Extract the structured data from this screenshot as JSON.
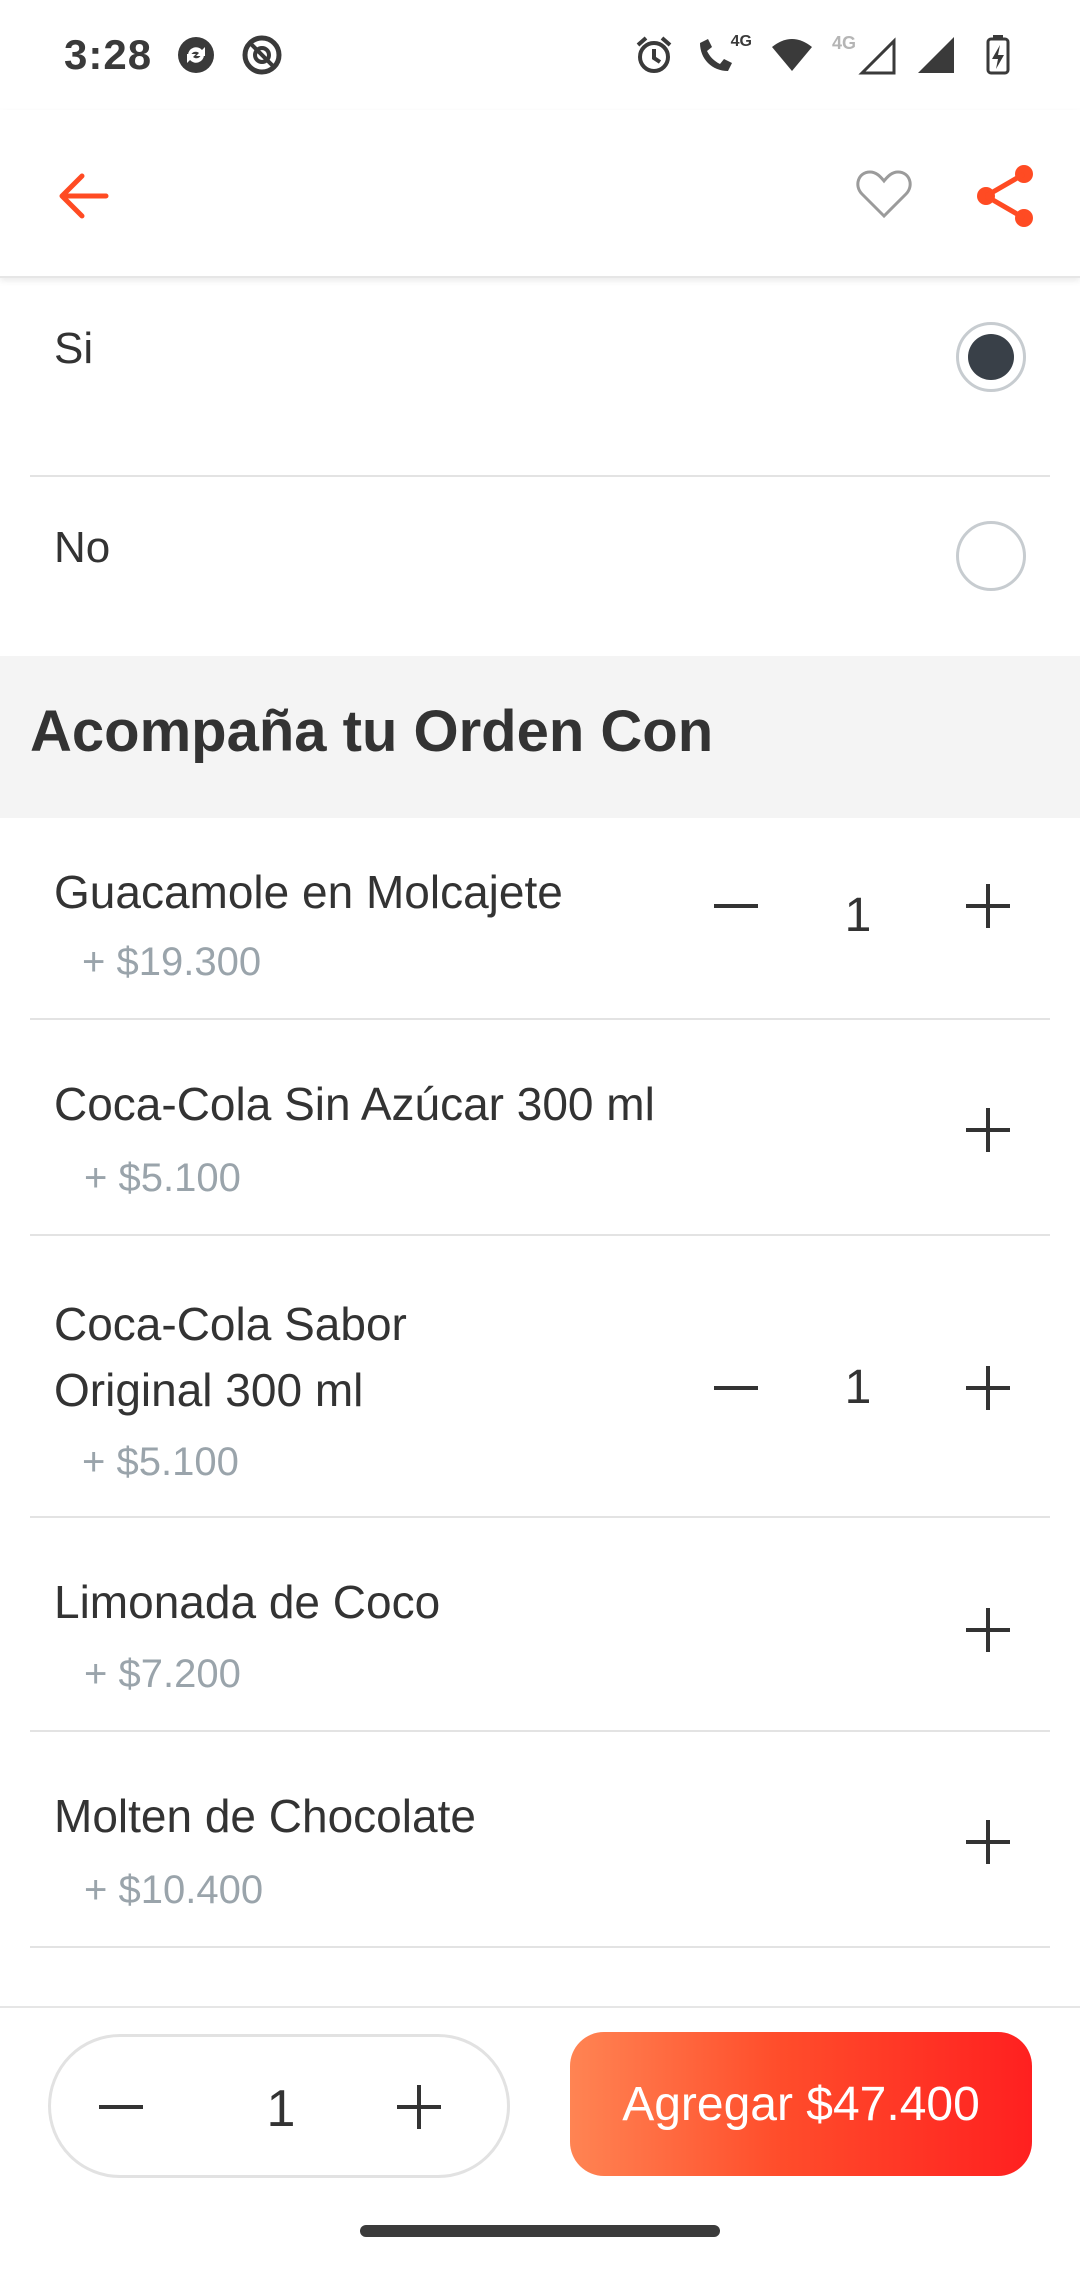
{
  "status_bar": {
    "time": "3:28",
    "left_icons": [
      "sync-icon",
      "no-disturb-icon"
    ],
    "right_icons": [
      "alarm-icon",
      "volte-call-icon",
      "wifi-icon",
      "signal-4g-icon",
      "signal-icon",
      "signal-icon-2",
      "battery-charging-icon"
    ],
    "call_badge": "4G",
    "network_badge": "4G"
  },
  "app_bar": {
    "back_icon": "arrow-left-icon",
    "favorite_icon": "heart-icon",
    "share_icon": "share-icon",
    "accent_color": "#ff4b23"
  },
  "options": [
    {
      "label": "Si",
      "selected": true
    },
    {
      "label": "No",
      "selected": false
    }
  ],
  "section": {
    "title": "Acompaña tu Orden Con"
  },
  "items": [
    {
      "name": "Guacamole en Molcajete",
      "price": "+ $19.300",
      "quantity": "1",
      "has_minus": true
    },
    {
      "name": "Coca-Cola Sin Azúcar 300 ml",
      "price": "+ $5.100",
      "quantity": "",
      "has_minus": false
    },
    {
      "name_line1": "Coca-Cola Sabor",
      "name_line2": "Original 300 ml",
      "price": "+ $5.100",
      "quantity": "1",
      "has_minus": true
    },
    {
      "name": "Limonada de Coco",
      "price": "+ $7.200",
      "quantity": "",
      "has_minus": false
    },
    {
      "name": "Molten de Chocolate",
      "price": "+ $10.400",
      "quantity": "",
      "has_minus": false
    }
  ],
  "footer": {
    "quantity": "1",
    "add_button_label": "Agregar $47.400",
    "button_gradient": [
      "#ff8453",
      "#ff2020"
    ]
  }
}
